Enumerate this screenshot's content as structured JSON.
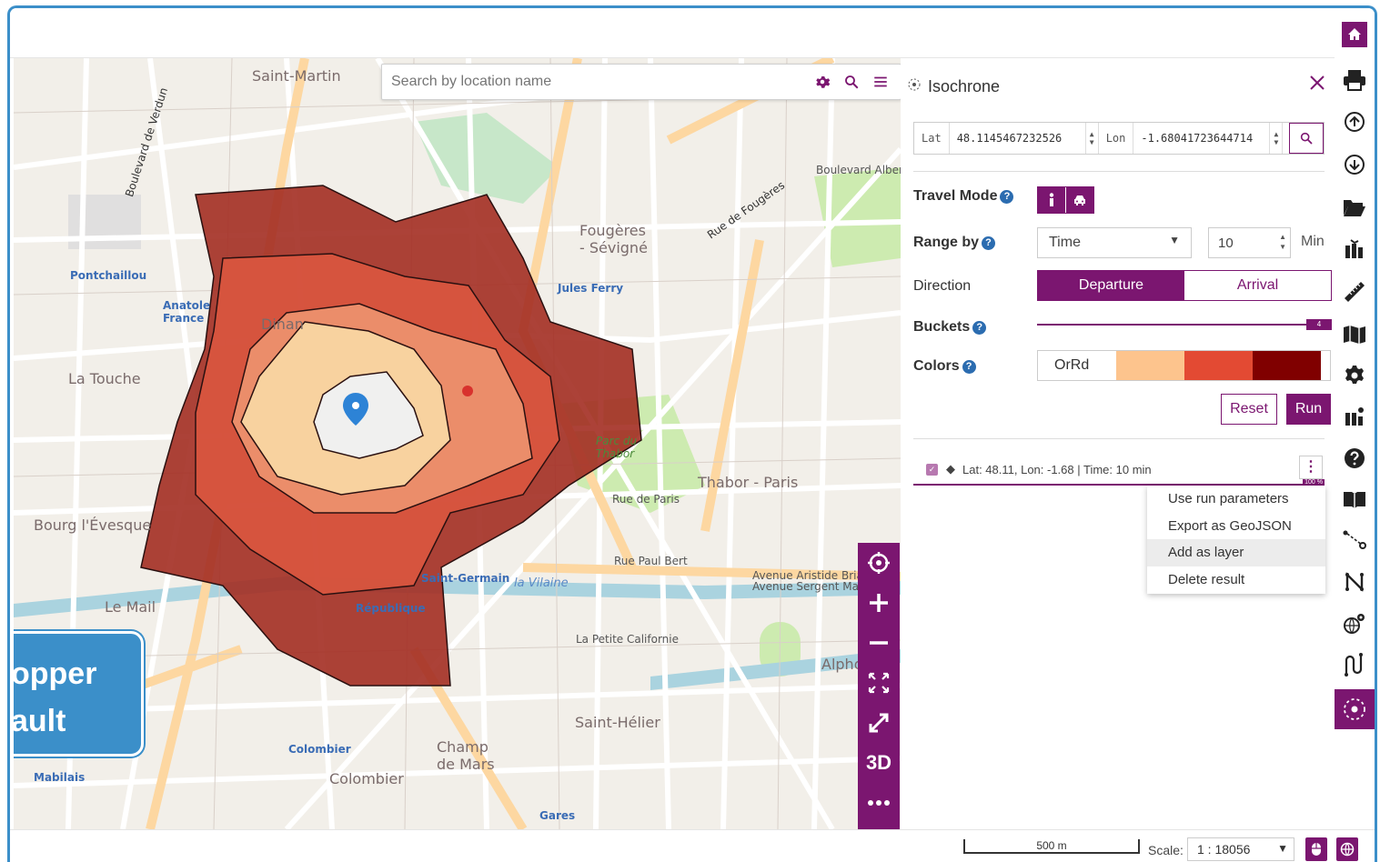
{
  "search": {
    "placeholder": "Search by location name"
  },
  "map": {
    "labels": {
      "saint_martin": "Saint-Martin",
      "fougeres_sevigne": "Fougères - Sévigné",
      "la_touche": "La Touche",
      "bourg_eveque": "Bourg l'Évesque",
      "thabor_paris": "Thabor - Paris",
      "le_mail": "Le Mail",
      "champ_de_mars": "Champ de Mars",
      "saint_helier": "Saint-Hélier",
      "colombier": "Colombier",
      "dinan": "Dinan",
      "pontchaillou": "Pontchaillou",
      "anatole_france": "Anatole France",
      "jules_ferry": "Jules Ferry",
      "la_vilaine": "la Vilaine",
      "la_petite_californie": "La Petite Californie",
      "republique": "République",
      "saint_germain": "Saint-Germain",
      "parc_du_thabor": "Parc du Thabor",
      "gares": "Gares",
      "mabilais": "Mabilais",
      "alpho": "Alpho",
      "boulevard_de_verdun": "Boulevard de Verdun",
      "boulevard_albert": "Boulevard Albert Bur",
      "rue_de_fougeres": "Rue de Fougères",
      "rue_de_paris": "Rue de Paris",
      "rue_paul_bert": "Rue Paul Bert",
      "avenue_aristide": "Avenue Aristide Brian",
      "avenue_sergent": "Avenue Sergent Magin"
    },
    "controls": [
      "locate-icon",
      "zoom-in-icon",
      "zoom-out-icon",
      "fit-icon",
      "fullscreen-icon",
      "3D",
      "more-icon"
    ],
    "controls_3d": "3D"
  },
  "graphhopper_tooltip": {
    "line1": "opper",
    "line2": "ault"
  },
  "isochrone": {
    "title": "Isochrone",
    "lat_label": "Lat",
    "lat_value": "48.1145467232526",
    "lon_label": "Lon",
    "lon_value": "-1.68041723644714",
    "travel_mode_label": "Travel Mode",
    "range_by_label": "Range by",
    "range_by_value": "Time",
    "range_value": "10",
    "range_unit": "Min",
    "direction_label": "Direction",
    "direction_options": [
      "Departure",
      "Arrival"
    ],
    "direction_selected": "Departure",
    "buckets_label": "Buckets",
    "buckets_value": "4",
    "colors_label": "Colors",
    "colors_scheme": "OrRd",
    "colors_swatches": [
      "#fdc48d",
      "#e34a33",
      "#800000"
    ],
    "reset_label": "Reset",
    "run_label": "Run",
    "result_text": "Lat: 48.11, Lon: -1.68 | Time: 10 min",
    "result_progress": "100 %",
    "menu_items": [
      "Use run parameters",
      "Export as GeoJSON",
      "Add as layer",
      "Delete result"
    ],
    "menu_highlighted": "Add as layer"
  },
  "footer": {
    "scalebar_label": "500 m",
    "scale_label": "Scale:",
    "scale_value": "1 : 18056"
  },
  "colors": {
    "accent": "#7b1670",
    "frame_border": "#3b8fc9",
    "iso_ring_1": "#f0f0ef",
    "iso_ring_2": "#f8d29f",
    "iso_ring_3": "#eb8d6a",
    "iso_ring_4": "#d8553f",
    "iso_ring_5": "#a32d22"
  }
}
